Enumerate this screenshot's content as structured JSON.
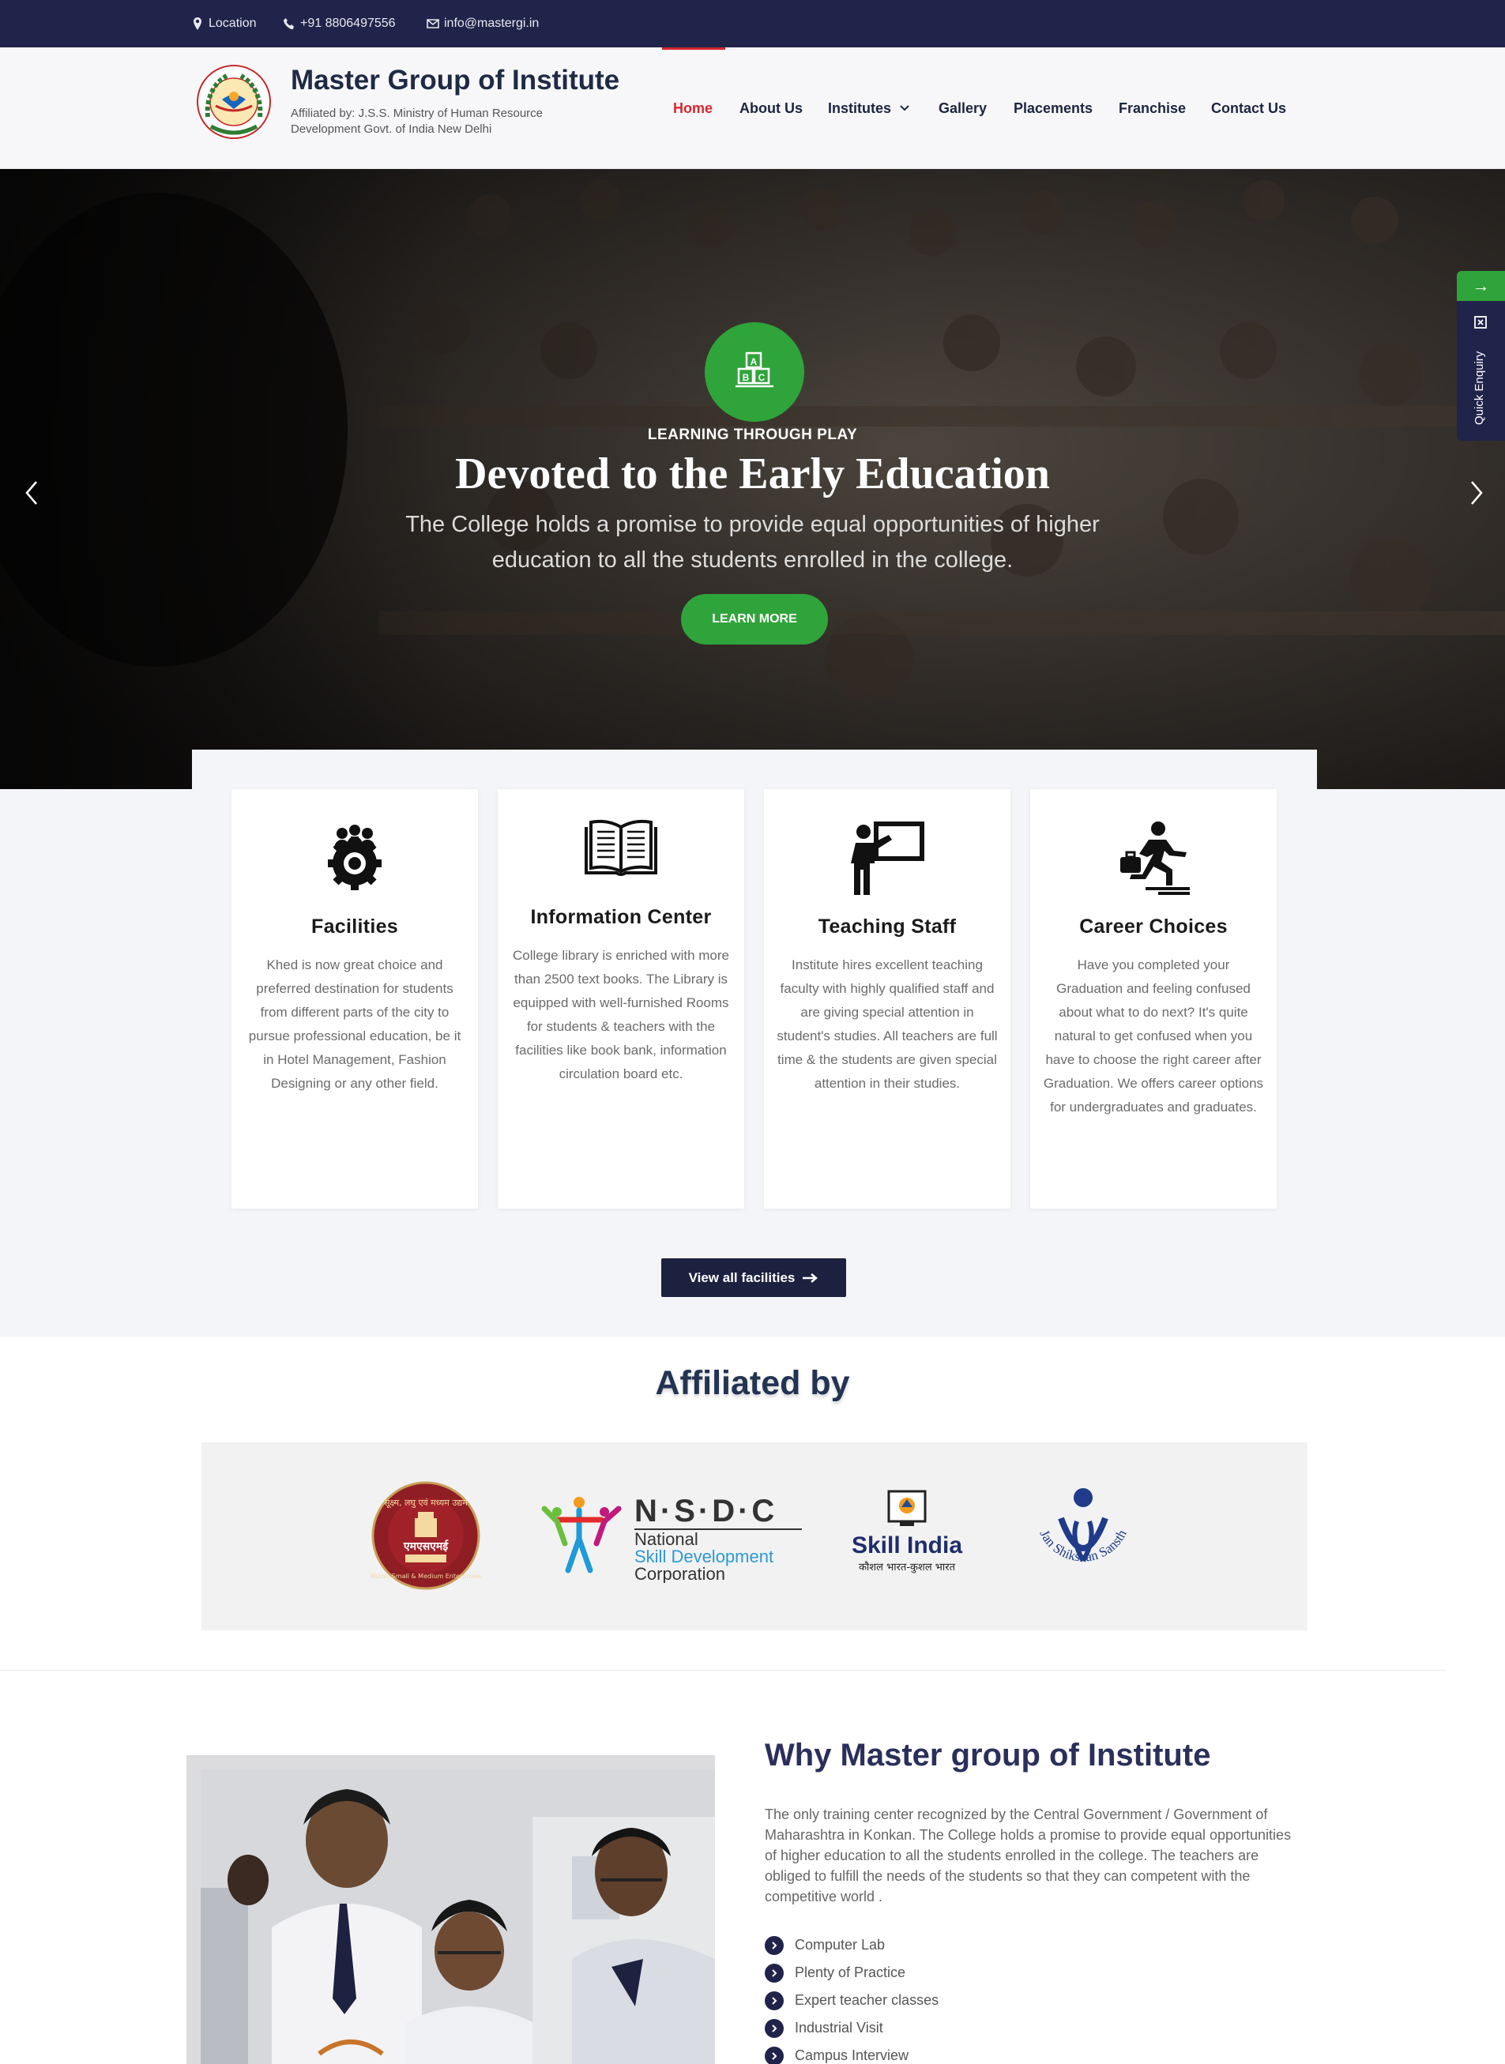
{
  "topbar": {
    "location": "Location",
    "phone": "+91 8806497556",
    "email": "info@mastergi.in"
  },
  "header": {
    "title": "Master Group of Institute",
    "subtitle": "Affiliated by: J.S.S. Ministry of Human Resource Development Govt. of India New Delhi",
    "logo_text": "Master Group of Institutes"
  },
  "nav": {
    "items": [
      "Home",
      "About Us",
      "Institutes",
      "Gallery",
      "Placements",
      "Franchise",
      "Contact Us"
    ],
    "active": "Home"
  },
  "hero": {
    "kicker": "LEARNING THROUGH PLAY",
    "title": "Devoted to the Early Education",
    "text": "The College holds a promise to provide equal opportunities of higher education to all the students enrolled in the college.",
    "button": "LEARN MORE",
    "badge_icon": "abc-blocks-icon"
  },
  "quick_enquiry": {
    "label": "Quick Enquiry",
    "arrow": "→"
  },
  "facilities": [
    {
      "title": "Facilities",
      "text": "Khed is now great choice and preferred destination for students from different parts of the city to pursue professional education, be it in Hotel Management, Fashion Designing or any other field.",
      "icon": "people-gear-icon"
    },
    {
      "title": "Information Center",
      "text": "College library is enriched with more than 2500 text books. The Library is equipped with well-furnished Rooms for students & teachers with the facilities like book bank, information circulation board etc.",
      "icon": "open-book-icon"
    },
    {
      "title": "Teaching Staff",
      "text": "Institute hires excellent teaching faculty with highly qualified staff and are giving special attention in student's studies. All teachers are full time & the students are given special attention in their studies.",
      "icon": "teacher-board-icon"
    },
    {
      "title": "Career Choices",
      "text": "Have you completed your Graduation and feeling confused about what to do next? It's quite natural to get confused when you have to choose the right career after Graduation. We offers career options for undergraduates and graduates.",
      "icon": "career-runner-icon"
    }
  ],
  "view_all": "View all facilities",
  "affiliated": {
    "title": "Affiliated by",
    "logos": {
      "msme_top": "सूक्ष्म, लघु एवं मध्यम उद्यम",
      "msme_mid": "एमएसएमई",
      "msme_bottom": "Micro, Small & Medium Enterprises",
      "nsdc_letters": "N·S·D·C",
      "nsdc_line1": "National",
      "nsdc_line2": "Skill Development",
      "nsdc_line3": "Corporation",
      "skill_india": "Skill India",
      "skill_india_tag": "कौशल भारत-कुशल भारत",
      "jss": "Jan Shikshan Sansthan"
    }
  },
  "why": {
    "title": "Why Master group of Institute",
    "text": "The only training center recognized by the Central Government / Government of Maharashtra in Konkan. The College holds a promise to provide equal opportunities of higher education to all the students enrolled in the college. The teachers are obliged to fulfill the needs of the students so that they can competent with the competitive world .",
    "list": [
      "Computer Lab",
      "Plenty of Practice",
      "Expert teacher classes",
      "Industrial Visit",
      "Campus Interview"
    ]
  },
  "colors": {
    "navy": "#21244a",
    "green": "#2fa43a",
    "red": "#d8262e",
    "title_blue": "#2a2f5b"
  }
}
